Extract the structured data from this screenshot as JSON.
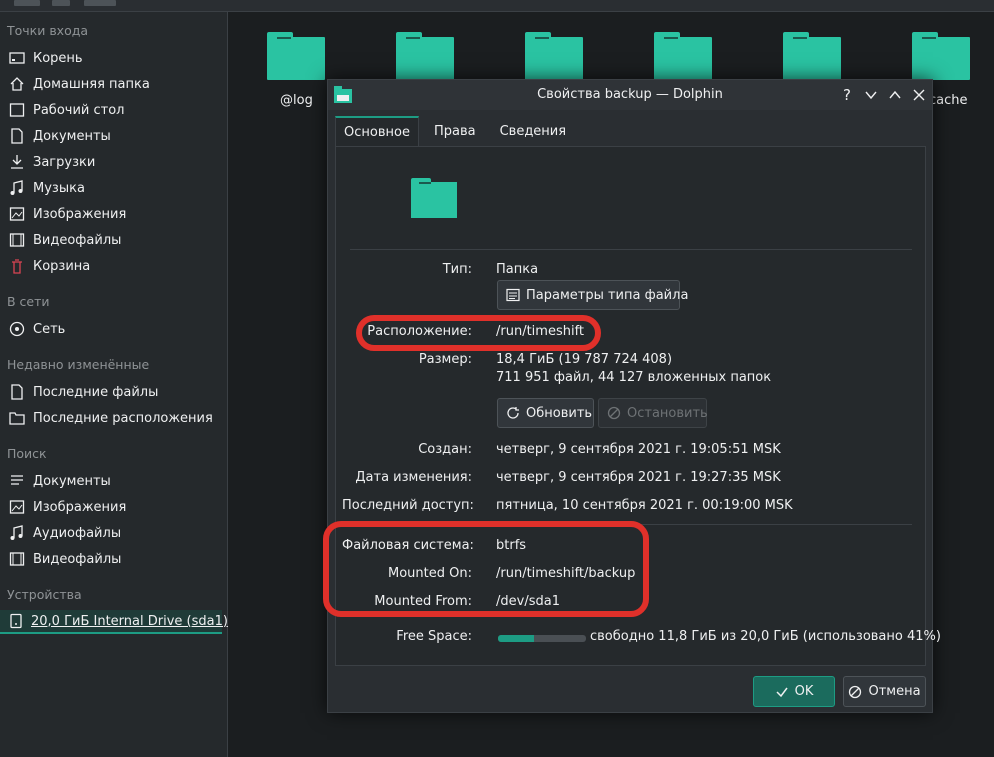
{
  "sidebar": {
    "sections": [
      {
        "title": "Точки входа",
        "items": [
          {
            "label": "Корень",
            "icon": "drive-icon"
          },
          {
            "label": "Домашняя папка",
            "icon": "home-icon"
          },
          {
            "label": "Рабочий стол",
            "icon": "desktop-icon"
          },
          {
            "label": "Документы",
            "icon": "documents-icon"
          },
          {
            "label": "Загрузки",
            "icon": "downloads-icon"
          },
          {
            "label": "Музыка",
            "icon": "music-icon"
          },
          {
            "label": "Изображения",
            "icon": "pictures-icon"
          },
          {
            "label": "Видеофайлы",
            "icon": "video-icon"
          },
          {
            "label": "Корзина",
            "icon": "trash-icon"
          }
        ]
      },
      {
        "title": "В сети",
        "items": [
          {
            "label": "Сеть",
            "icon": "network-icon"
          }
        ]
      },
      {
        "title": "Недавно изменённые",
        "items": [
          {
            "label": "Последние файлы",
            "icon": "recent-files-icon"
          },
          {
            "label": "Последние расположения",
            "icon": "recent-locations-icon"
          }
        ]
      },
      {
        "title": "Поиск",
        "items": [
          {
            "label": "Документы",
            "icon": "documents-search-icon"
          },
          {
            "label": "Изображения",
            "icon": "pictures-search-icon"
          },
          {
            "label": "Аудиофайлы",
            "icon": "audio-search-icon"
          },
          {
            "label": "Видеофайлы",
            "icon": "video-search-icon"
          }
        ]
      },
      {
        "title": "Устройства",
        "items": [
          {
            "label": "20,0 ГиБ Internal Drive (sda1)",
            "icon": "harddisk-icon"
          }
        ]
      }
    ]
  },
  "files": {
    "labels": [
      "@log",
      "cache"
    ]
  },
  "dialog": {
    "title": "Свойства backup — Dolphin",
    "tabs": [
      "Основное",
      "Права",
      "Сведения"
    ],
    "type_label": "Тип:",
    "type_value": "Папка",
    "filetype_button": "Параметры типа файла",
    "location_label": "Расположение:",
    "location_value": "/run/timeshift",
    "size_label": "Размер:",
    "size_value": "18,4 ГиБ (19 787 724 408)",
    "size_detail": "711 951 файл, 44 127 вложенных папок",
    "refresh_button": "Обновить",
    "stop_button": "Остановить",
    "created_label": "Создан:",
    "created_value": "четверг, 9 сентября 2021 г. 19:05:51 MSK",
    "modified_label": "Дата изменения:",
    "modified_value": "четверг, 9 сентября 2021 г. 19:27:35 MSK",
    "accessed_label": "Последний доступ:",
    "accessed_value": "пятница, 10 сентября 2021 г. 00:19:00 MSK",
    "fs_label": "Файловая система:",
    "fs_value": "btrfs",
    "mounted_on_label": "Mounted On:",
    "mounted_on_value": "/run/timeshift/backup",
    "mounted_from_label": "Mounted From:",
    "mounted_from_value": "/dev/sda1",
    "free_label": "Free Space:",
    "free_value": "свободно 11,8 ГиБ из 20,0 ГиБ (использовано 41%)",
    "used_fraction": 0.41,
    "ok_button": "OK",
    "cancel_button": "Отмена"
  },
  "colors": {
    "accent": "#1d9c84",
    "folder": "#2ac3a2",
    "highlight": "#e0302a"
  }
}
